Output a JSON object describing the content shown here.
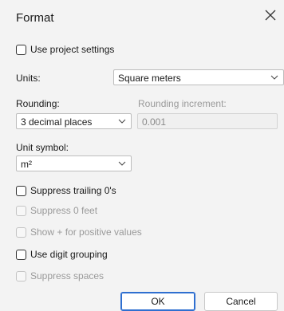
{
  "dialog": {
    "title": "Format"
  },
  "use_project_settings": {
    "label": "Use project settings"
  },
  "units": {
    "label": "Units:",
    "value": "Square meters"
  },
  "rounding": {
    "label": "Rounding:",
    "value": "3 decimal places"
  },
  "rounding_increment": {
    "label": "Rounding increment:",
    "value": "0.001"
  },
  "unit_symbol": {
    "label": "Unit symbol:",
    "value": "m²"
  },
  "checkboxes": {
    "suppress_trailing": "Suppress trailing 0's",
    "suppress_zero_feet": "Suppress 0 feet",
    "show_plus": "Show + for positive values",
    "digit_grouping": "Use digit grouping",
    "suppress_spaces": "Suppress spaces"
  },
  "buttons": {
    "ok": "OK",
    "cancel": "Cancel"
  },
  "icons": {
    "close": "close-icon",
    "dropdown": "chevron-down-icon"
  }
}
